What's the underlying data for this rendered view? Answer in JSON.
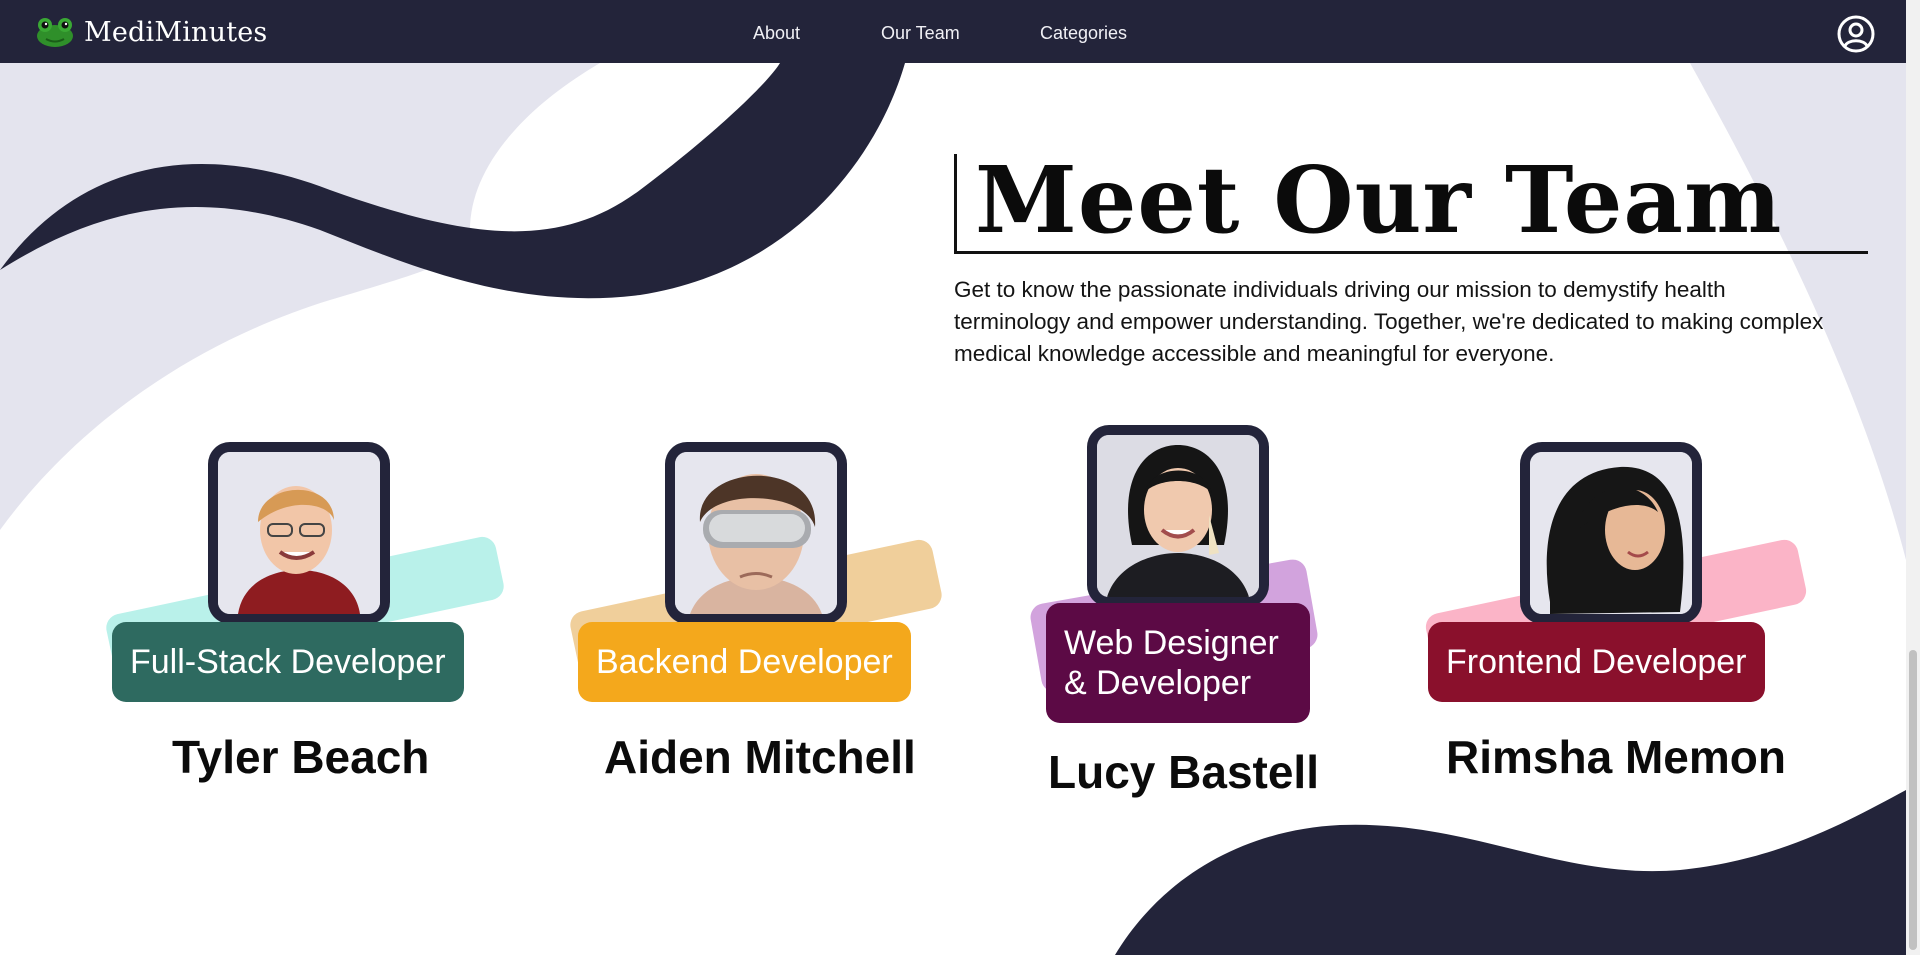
{
  "nav": {
    "brand": "MediMinutes",
    "links": [
      "About",
      "Our Team",
      "Categories"
    ]
  },
  "page": {
    "title": "Meet Our Team",
    "intro": "Get to know the passionate individuals driving our mission to demystify health terminology and empower understanding. Together, we're dedicated to making complex medical knowledge accessible and meaningful for everyone."
  },
  "members": [
    {
      "name": "Tyler Beach",
      "role": "Full-Stack Developer",
      "badge_color": "#2e6a60",
      "accent_color": "#b9f1ea"
    },
    {
      "name": "Aiden Mitchell",
      "role": "Backend Developer",
      "badge_color": "#f4a81c",
      "accent_color": "#f0cf9b"
    },
    {
      "name": "Lucy Bastell",
      "role_line1": "Web Designer",
      "role_line2": "& Developer",
      "badge_color": "#5c0a45",
      "accent_color": "#d2a3dd"
    },
    {
      "name": "Rimsha Memon",
      "role": "Frontend Developer",
      "badge_color": "#8a102c",
      "accent_color": "#fbb4c7"
    }
  ],
  "colors": {
    "navy": "#23243a",
    "lavender_bg": "#e4e4ee"
  },
  "icons": [
    "frog-logo-icon",
    "user-circle-icon"
  ]
}
